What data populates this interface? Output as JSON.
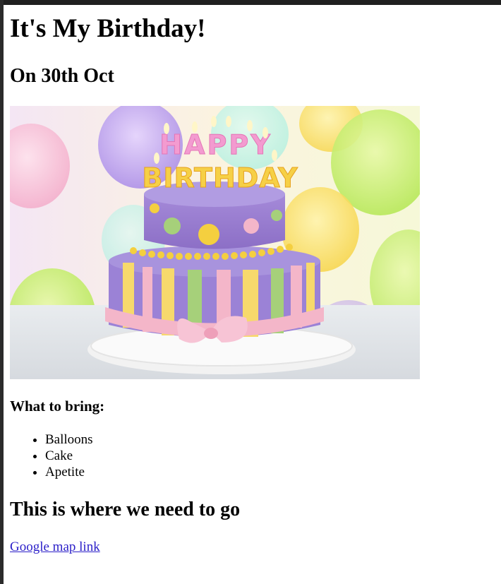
{
  "header": {
    "title": "It's My Birthday!",
    "date": "On 30th Oct"
  },
  "image": {
    "alt": "Happy Birthday cake",
    "topper_line1": "HAPPY",
    "topper_line2": "BIRTHDAY"
  },
  "bring": {
    "heading": "What to bring:",
    "items": [
      "Balloons",
      "Cake",
      "Apetite"
    ]
  },
  "location": {
    "heading": "This is where we need to go",
    "link_text": "Google map link"
  },
  "colors": {
    "link": "#2a1ec8",
    "text": "#000000",
    "cake_purple": "#9b7fd0",
    "cake_pink": "#f4b6c9"
  }
}
